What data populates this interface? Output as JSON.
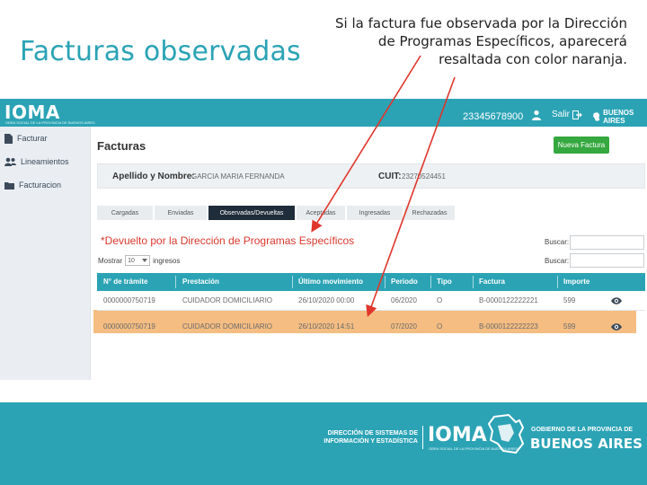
{
  "slide": {
    "title": "Facturas observadas",
    "note": "Si la factura fue observada por la Dirección de Programas Específicos, aparecerá resaltada con color naranja."
  },
  "topbar": {
    "logo": "IOMA",
    "logo_sub": "OBRA SOCIAL DE LA PROVINCIA DE BUENOS AIRES",
    "user_id": "23345678900",
    "logout_label": "Salir",
    "ba_logo": "BUENOS AIRES"
  },
  "sidebar": {
    "items": [
      {
        "label": "Facturar",
        "icon": "file-icon"
      },
      {
        "label": "Lineamientos",
        "icon": "users-icon"
      },
      {
        "label": "Facturacion",
        "icon": "folder-icon"
      }
    ]
  },
  "main": {
    "title": "Facturas",
    "new_button": "Nueva Factura",
    "name_label": "Apellido y Nombre:",
    "name_value": "GARCIA MARIA FERNANDA",
    "cuit_label": "CUIT:",
    "cuit_value": "23270524451",
    "tabs": [
      {
        "label": "Cargadas"
      },
      {
        "label": "Enviadas"
      },
      {
        "label": "Observadas/Devueltas",
        "active": true
      },
      {
        "label": "Aceptadas"
      },
      {
        "label": "Ingresadas"
      },
      {
        "label": "Rechazadas"
      }
    ],
    "notice": "*Devuelto por la Dirección de Programas Específicos",
    "search_label_1": "Buscar:",
    "search_label_2": "Buscar:",
    "show_label": "Mostrar",
    "show_value": "10",
    "show_suffix": "ingresos"
  },
  "table": {
    "headers": [
      "N° de trámite",
      "Prestación",
      "Último movimiento",
      "Periodo",
      "Tipo",
      "Factura",
      "Importe"
    ],
    "rows": [
      [
        "0000000750719",
        "CUIDADOR DOMICILIARIO",
        "26/10/2020 00:00",
        "06/2020",
        "O",
        "B-0000122222221",
        "599"
      ],
      [
        "0000000750719",
        "CUIDADOR DOMICILIARIO",
        "26/10/2020 14:51",
        "07/2020",
        "O",
        "B-0000122222223",
        "599"
      ]
    ],
    "highlight_color": "#f5bd82"
  },
  "footer": {
    "dir_line1": "DIRECCIÓN DE SISTEMAS DE",
    "dir_line2": "INFORMACIÓN Y ESTADÍSTICA",
    "ioma": "IOMA",
    "ioma_sub": "OBRA SOCIAL DE LA PROVINCIA DE BUENOS AIRES",
    "gov_line": "GOBIERNO DE LA PROVINCIA DE",
    "gov_main": "BUENOS AIRES"
  },
  "colors": {
    "accent": "#2ba3b5",
    "notice": "#d9382c",
    "new_button": "#35a83f",
    "active_tab": "#1f2c3a",
    "arrow": "#e0352b"
  }
}
